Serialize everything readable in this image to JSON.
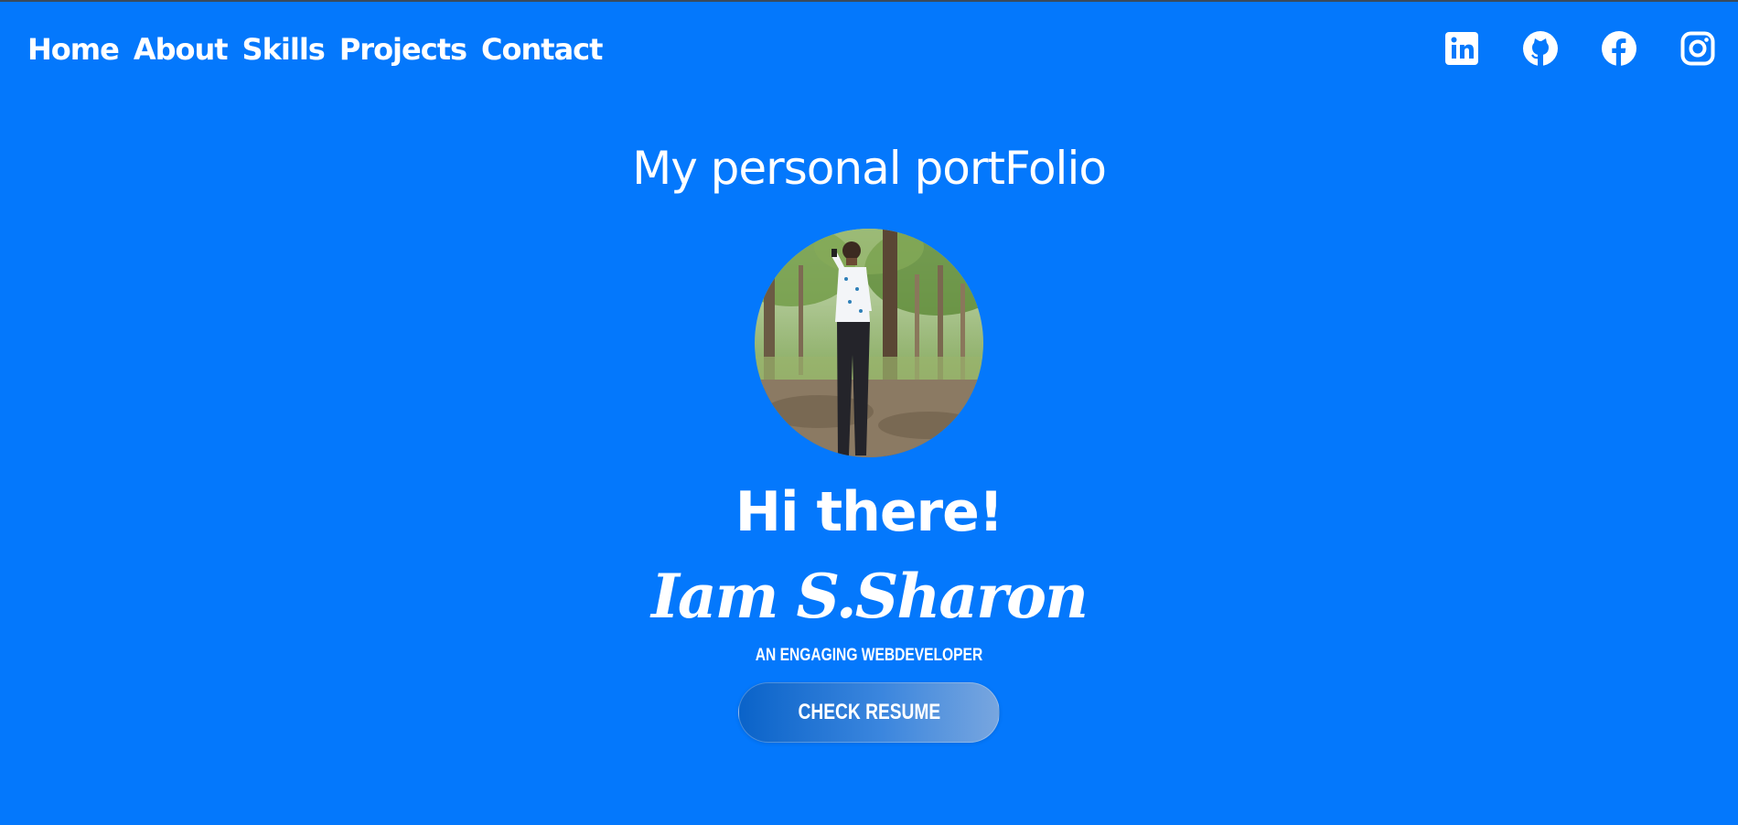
{
  "nav": {
    "items": [
      {
        "label": "Home"
      },
      {
        "label": "About"
      },
      {
        "label": "Skills"
      },
      {
        "label": "Projects"
      },
      {
        "label": "Contact"
      }
    ]
  },
  "socials": [
    {
      "icon": "linkedin-icon"
    },
    {
      "icon": "github-icon"
    },
    {
      "icon": "facebook-icon"
    },
    {
      "icon": "instagram-icon"
    }
  ],
  "hero": {
    "subtitle": "My personal portFolio",
    "greeting": "Hi there!",
    "name": "Iam S.Sharon",
    "tagline": "AN ENGAGING WEBDEVELOPER",
    "button_label": "CHECK RESUME"
  },
  "colors": {
    "background": "#0478fc",
    "text": "#ffffff",
    "button_gradient_start": "#0a63c9",
    "button_gradient_end": "#78a6df"
  }
}
